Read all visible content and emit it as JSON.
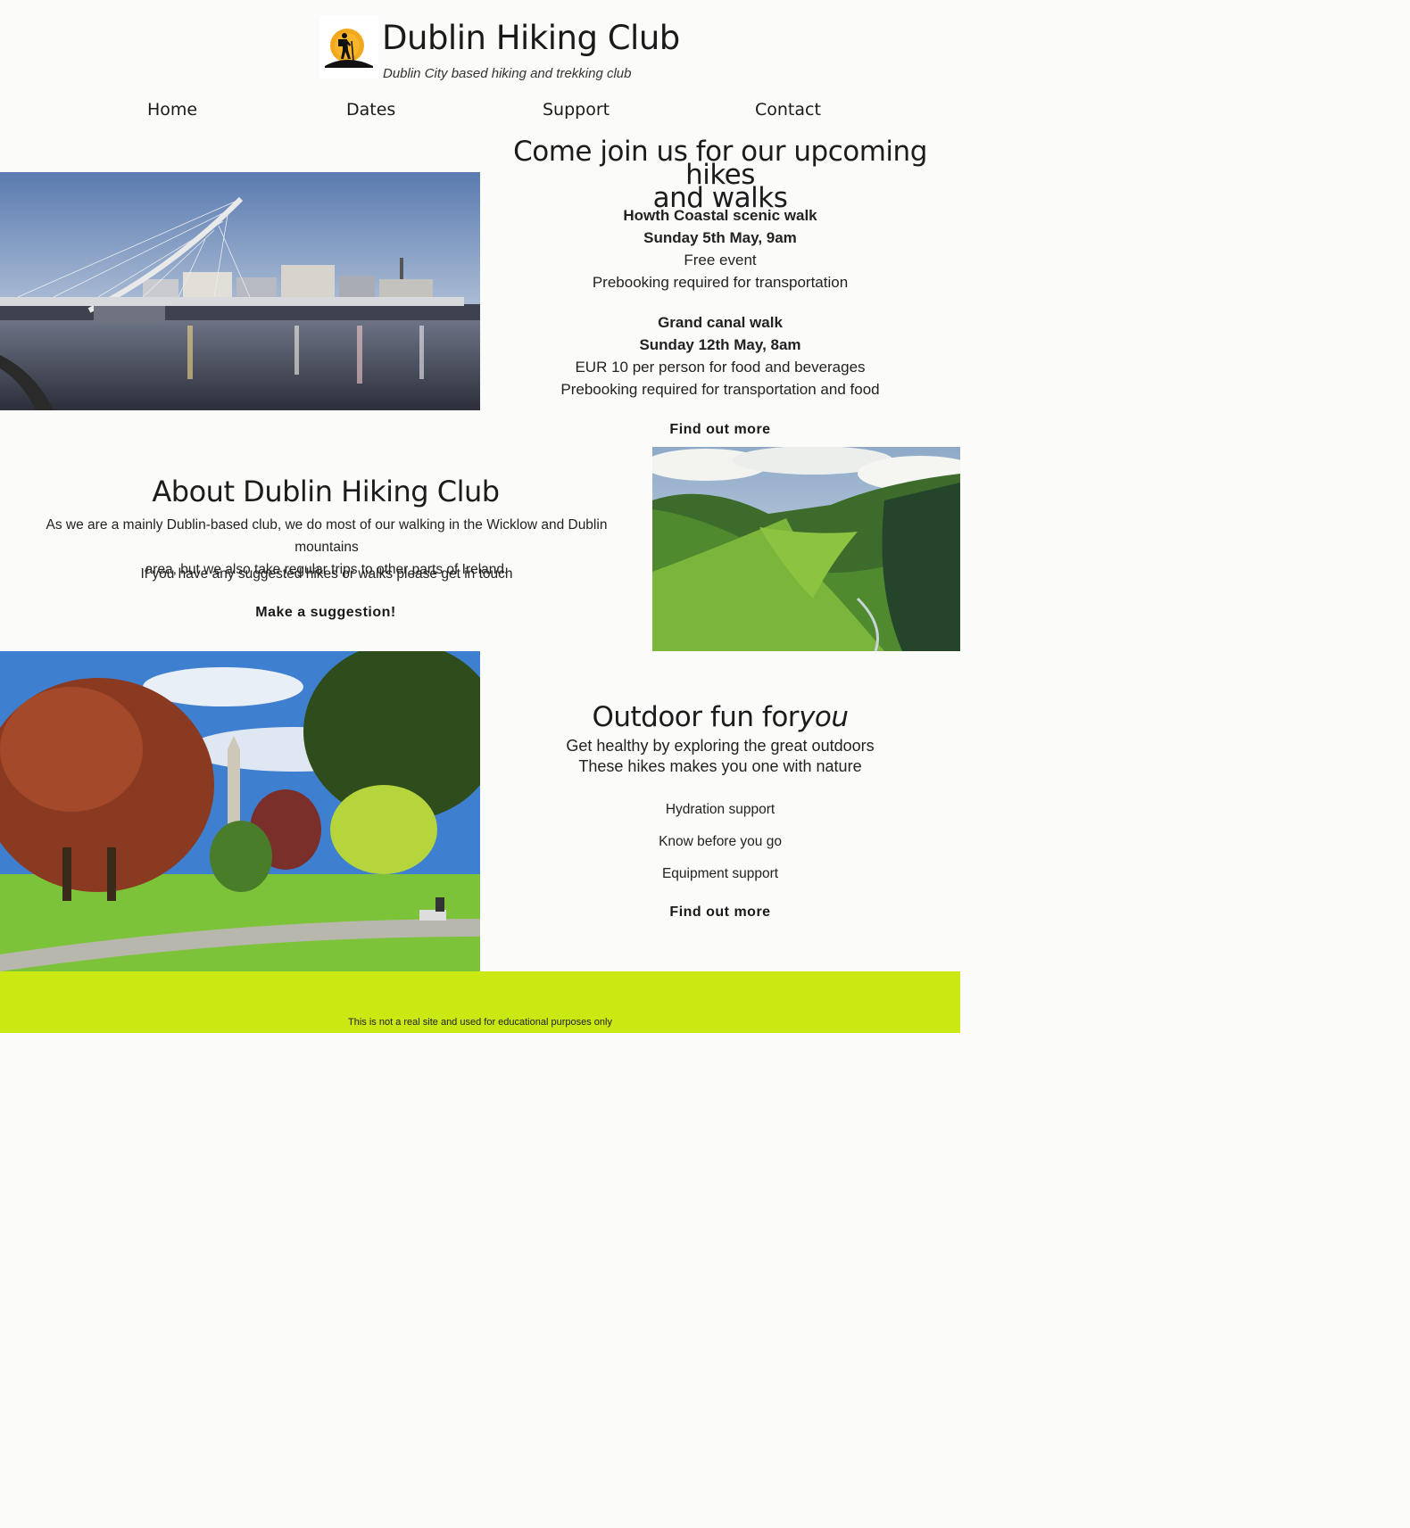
{
  "header": {
    "logo_icon": "hiker-sun-logo-icon",
    "title": "Dublin Hiking Club",
    "tagline": "Dublin City based hiking and trekking club"
  },
  "nav": {
    "items": [
      {
        "label": "Home"
      },
      {
        "label": "Dates"
      },
      {
        "label": "Support"
      },
      {
        "label": "Contact"
      }
    ]
  },
  "upcoming": {
    "heading_line1": "Come join us for our upcoming hikes",
    "heading_line2": "and walks",
    "events": [
      {
        "name": "Howth Coastal scenic walk",
        "date": "Sunday 5th May, 9am",
        "price": "Free event",
        "note": "Prebooking required for transportation"
      },
      {
        "name": "Grand canal walk",
        "date": "Sunday 12th May, 8am",
        "price": "EUR 10 per person for food and beverages",
        "note": "Prebooking required for transportation and food"
      }
    ],
    "cta": "Find out more"
  },
  "about": {
    "heading": "About Dublin Hiking Club",
    "para1_line1": "As we are a mainly Dublin-based club, we do most of our walking in the Wicklow and Dublin mountains",
    "para1_line2": "area, but we also take regular trips to other parts of Ireland.",
    "para2": "If you have any suggested hikes or walks please get in touch",
    "cta": "Make a suggestion!"
  },
  "outdoor": {
    "heading_main": "Outdoor fun for",
    "heading_em": "you",
    "sub1": "Get healthy by exploring the great outdoors",
    "sub2": "These hikes makes you one with nature",
    "features": [
      "Hydration support",
      "Know before you go",
      "Equipment support"
    ],
    "cta": "Find out more"
  },
  "footer": {
    "text": "This is not a real site and used for educational purposes only"
  },
  "colors": {
    "background": "#fbfbf9",
    "footer": "#cae812",
    "logo_sun": "#f2a81d"
  }
}
